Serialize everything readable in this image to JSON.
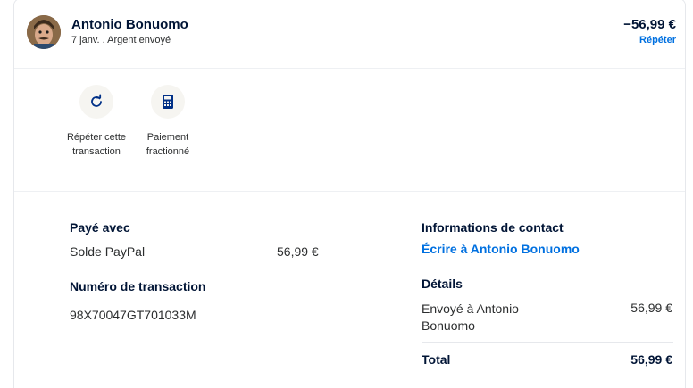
{
  "header": {
    "name": "Antonio Bonuomo",
    "meta": "7 janv. . Argent envoyé",
    "amount": "−56,99 €",
    "repeat_link": "Répéter"
  },
  "actions": [
    {
      "icon": "repeat-icon",
      "label": "Répéter cette transaction"
    },
    {
      "icon": "calculator-icon",
      "label": "Paiement fractionné"
    }
  ],
  "payment": {
    "paid_with_heading": "Payé avec",
    "method": "Solde PayPal",
    "method_amount": "56,99 €",
    "transaction_heading": "Numéro de transaction",
    "transaction_id": "98X70047GT701033M"
  },
  "contact": {
    "heading": "Informations de contact",
    "write_link": "Écrire à Antonio Bonuomo"
  },
  "details": {
    "heading": "Détails",
    "line_label_1": "Envoyé à Antonio",
    "line_label_2": "Bonuomo",
    "line_amount": "56,99 €",
    "total_label": "Total",
    "total_amount": "56,99 €"
  },
  "colors": {
    "text": "#001435",
    "link": "#0070e0",
    "icon_bg": "#f6f5f1"
  }
}
